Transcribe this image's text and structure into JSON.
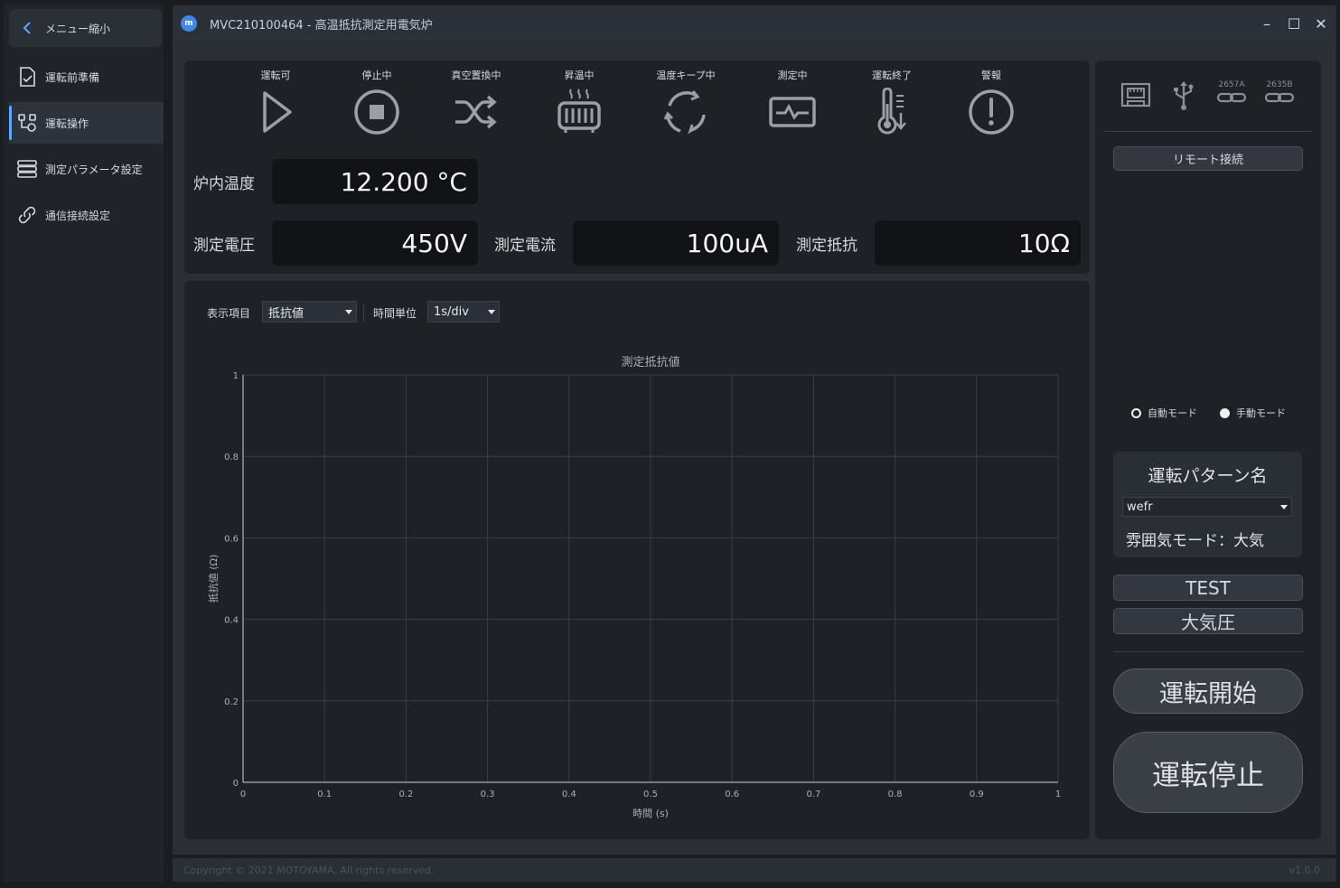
{
  "sidebar": {
    "collapse_label": "メニュー縮小",
    "items": [
      {
        "label": "運転前準備",
        "icon": "checklist-document-icon"
      },
      {
        "label": "運転操作",
        "icon": "control-flow-icon",
        "active": true
      },
      {
        "label": "測定パラメータ設定",
        "icon": "server-stack-icon"
      },
      {
        "label": "通信接続設定",
        "icon": "link-icon"
      }
    ]
  },
  "window": {
    "title": "MVC210100464 - 高温抵抗測定用電気炉",
    "minimize": "–",
    "maximize": "☐",
    "close": "✕"
  },
  "status": [
    {
      "label": "運転可",
      "icon": "play-icon"
    },
    {
      "label": "停止中",
      "icon": "stop-icon"
    },
    {
      "label": "真空置換中",
      "icon": "shuffle-icon"
    },
    {
      "label": "昇温中",
      "icon": "heater-icon"
    },
    {
      "label": "温度キープ中",
      "icon": "cycle-icon"
    },
    {
      "label": "測定中",
      "icon": "monitor-pulse-icon"
    },
    {
      "label": "運転終了",
      "icon": "thermometer-down-icon"
    },
    {
      "label": "警報",
      "icon": "alert-icon"
    }
  ],
  "readouts": {
    "furnace_temp_label": "炉内温度",
    "furnace_temp_value": "12.200 °C",
    "voltage_label": "測定電圧",
    "voltage_value": "450V",
    "current_label": "測定電流",
    "current_value": "100uA",
    "resistance_label": "測定抵抗",
    "resistance_value": "10Ω"
  },
  "chart_controls": {
    "display_item_label": "表示項目",
    "display_item_value": "抵抗値",
    "time_unit_label": "時間単位",
    "time_unit_value": "1s/div"
  },
  "chart_data": {
    "type": "line",
    "title": "測定抵抗値",
    "xlabel": "時間 (s)",
    "ylabel": "抵抗値 (Ω)",
    "xlim": [
      0,
      1
    ],
    "ylim": [
      0,
      1
    ],
    "x_ticks": [
      "0",
      "0.1",
      "0.2",
      "0.3",
      "0.4",
      "0.5",
      "0.6",
      "0.7",
      "0.8",
      "0.9",
      "1"
    ],
    "y_ticks": [
      "0",
      "0.2",
      "0.4",
      "0.6",
      "0.8",
      "1"
    ],
    "grid": true,
    "series": []
  },
  "right": {
    "conn_icons": [
      {
        "icon": "ethernet-icon",
        "label": ""
      },
      {
        "icon": "usb-icon",
        "label": ""
      },
      {
        "icon": "link-icon",
        "label": "2657A"
      },
      {
        "icon": "link-icon",
        "label": "2635B"
      }
    ],
    "remote_button": "リモート接続",
    "auto_mode": "自動モード",
    "manual_mode": "手動モード",
    "pattern_title": "運転パターン名",
    "pattern_value": "wefr",
    "atmosphere_mode": "雰囲気モード：大気",
    "test_button": "TEST",
    "atm_button": "大気圧",
    "start_button": "運転開始",
    "stop_button": "運転停止"
  },
  "footer": {
    "copyright": "Copyright © 2021 MOTOYAMA. All rights reserved.",
    "version": "v1.0.0"
  }
}
